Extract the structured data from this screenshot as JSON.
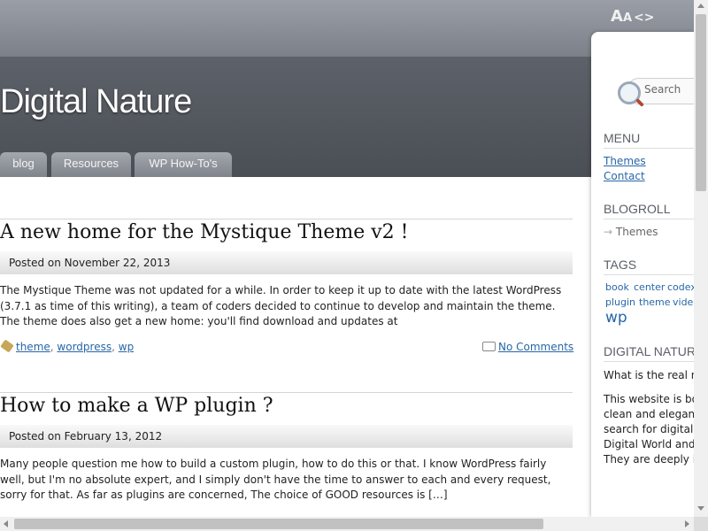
{
  "font_controls": {
    "big": "A",
    "small": "A",
    "arrows": "<>"
  },
  "site": {
    "title": "Digital Nature"
  },
  "nav": {
    "tabs": [
      "blog",
      "Resources",
      "WP How-To's"
    ]
  },
  "posts": [
    {
      "title": "A new home for the Mystique Theme v2 !",
      "meta": "Posted on November 22, 2013",
      "body": "The Mystique Theme was not updated for a while. In order to keep it up to date with the latest WordPress (3.7.1 as time of this writing), a team of coders decided to continue to develop and maintain the theme. The theme does also get a new home: you'll find download and updates at",
      "tags": [
        "theme",
        "wordpress",
        "wp"
      ],
      "tag_separator": ",",
      "comments": "No Comments"
    },
    {
      "title": "How to make a WP plugin ?",
      "meta": "Posted on February 13, 2012",
      "body": "Many people question me how to build a custom plugin, how to do this or that. I know WordPress fairly well, but I'm no absolute expert, and I simply don't have the time to answer to each and every request, sorry for that. As far as plugins are concerned, The choice of GOOD resources is […]"
    }
  ],
  "sidebar": {
    "search_placeholder": "Search",
    "menu_heading": "MENU",
    "menu_items": [
      "Themes",
      "Contact"
    ],
    "blogroll_heading": "BLOGROLL",
    "blogroll_items": [
      "Themes"
    ],
    "blogroll_arrow": "→",
    "tags_heading": "TAGS",
    "tag_cloud": [
      "book",
      "center",
      "codex",
      "plugin",
      "theme",
      "video",
      "wp"
    ],
    "about_heading": "DIGITAL NATUR",
    "about_lines": [
      "What is the real n",
      "This website is bo",
      "clean and elegant",
      "search for digital",
      "Digital World and",
      "They are deeply in"
    ]
  },
  "colors": {
    "link": "#2866a8",
    "header_bg": "#52565d",
    "tab_bg": "#8f939a"
  },
  "icons": [
    "tag-icon",
    "comment-icon",
    "search-icon",
    "scroll-arrow-icon"
  ]
}
